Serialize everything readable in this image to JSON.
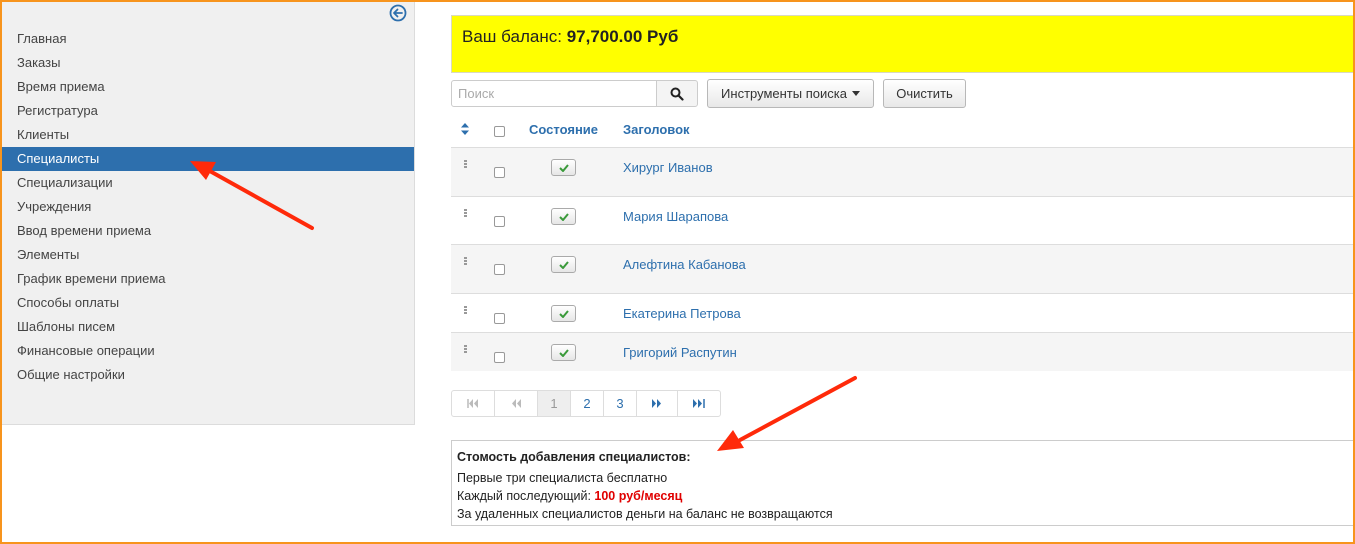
{
  "sidebar": {
    "toggle_icon": "circle-arrow-left-icon",
    "items": [
      {
        "label": "Главная",
        "active": false
      },
      {
        "label": "Заказы",
        "active": false
      },
      {
        "label": "Время приема",
        "active": false
      },
      {
        "label": "Регистратура",
        "active": false
      },
      {
        "label": "Клиенты",
        "active": false
      },
      {
        "label": "Специалисты",
        "active": true
      },
      {
        "label": "Специализации",
        "active": false
      },
      {
        "label": "Учреждения",
        "active": false
      },
      {
        "label": "Ввод времени приема",
        "active": false
      },
      {
        "label": "Элементы",
        "active": false
      },
      {
        "label": "График времени приема",
        "active": false
      },
      {
        "label": "Способы оплаты",
        "active": false
      },
      {
        "label": "Шаблоны писем",
        "active": false
      },
      {
        "label": "Финансовые операции",
        "active": false
      },
      {
        "label": "Общие настройки",
        "active": false
      }
    ]
  },
  "balance": {
    "label": "Ваш баланс:",
    "amount": "97,700.00 Руб"
  },
  "toolbar": {
    "search_placeholder": "Поиск",
    "search_icon": "search-icon",
    "tools_label": "Инструменты поиска",
    "clear_label": "Очистить"
  },
  "table": {
    "columns": {
      "status": "Состояние",
      "title": "Заголовок"
    },
    "rows": [
      {
        "title": "Хирург Иванов",
        "published": true
      },
      {
        "title": "Мария Шарапова",
        "published": true
      },
      {
        "title": "Алефтина Кабанова",
        "published": true
      },
      {
        "title": "Екатерина Петрова",
        "published": true
      },
      {
        "title": "Григорий Распутин",
        "published": true
      }
    ]
  },
  "pagination": {
    "pages": [
      "1",
      "2",
      "3"
    ],
    "current": "1"
  },
  "info": {
    "heading": "Стомость добавления специалистов:",
    "line1": "Первые три специалиста бесплатно",
    "line2_prefix": "Каждый последующий:",
    "line2_price": "100 руб/месяц",
    "line3": "За удаленных специалистов деньги на баланс не возвращаются"
  },
  "colors": {
    "accent": "#2d6fad",
    "balance_bg": "#ffff00",
    "price": "#e00000",
    "annotation_arrow": "#ff2a0a",
    "frame": "#f7941d"
  }
}
